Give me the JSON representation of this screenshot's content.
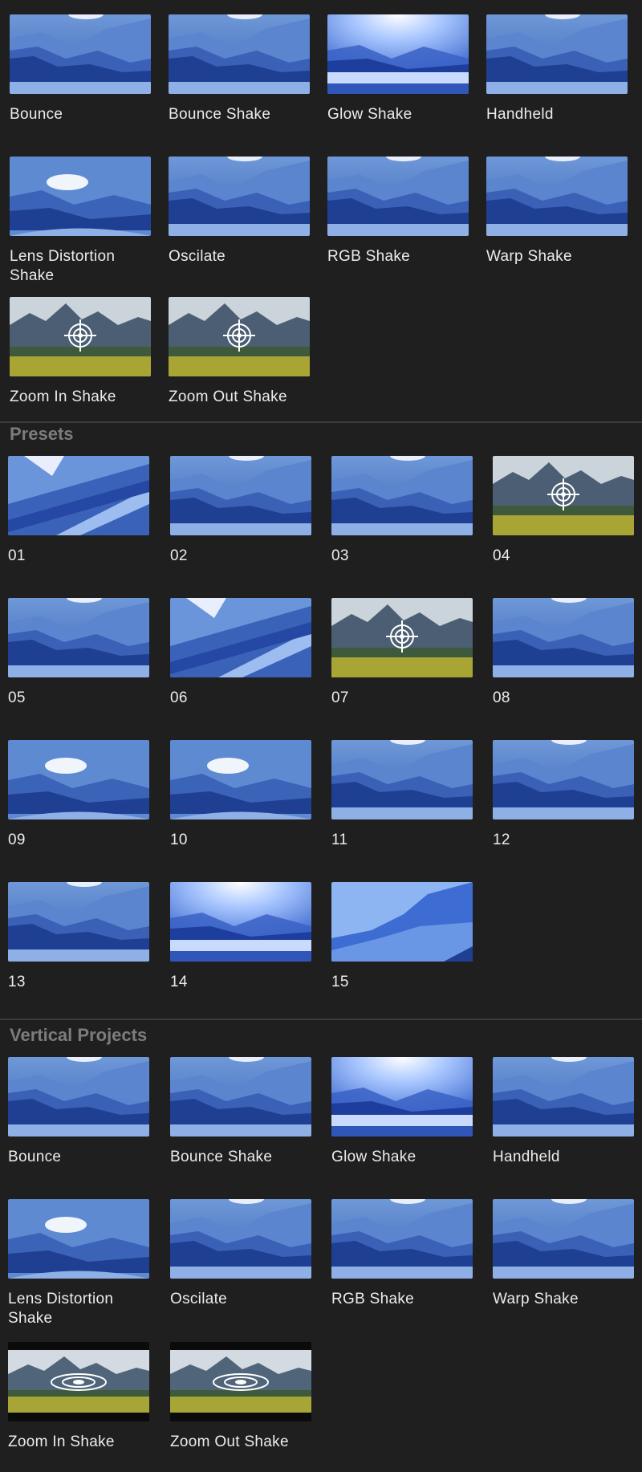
{
  "sections": [
    {
      "title": "",
      "items": [
        {
          "label": "Bounce",
          "thumb": "mountains-blue"
        },
        {
          "label": "Bounce Shake",
          "thumb": "mountains-blue"
        },
        {
          "label": "Glow Shake",
          "thumb": "mountains-glow"
        },
        {
          "label": "Handheld",
          "thumb": "mountains-blue"
        },
        {
          "label": "Lens Distortion Shake",
          "thumb": "mountains-lens"
        },
        {
          "label": "Oscilate",
          "thumb": "mountains-blue"
        },
        {
          "label": "RGB Shake",
          "thumb": "mountains-blue"
        },
        {
          "label": "Warp Shake",
          "thumb": "mountains-blue"
        },
        {
          "label": "Zoom In Shake",
          "thumb": "landscape-target"
        },
        {
          "label": "Zoom Out Shake",
          "thumb": "landscape-target"
        }
      ]
    },
    {
      "title": "Presets",
      "items": [
        {
          "label": "01",
          "thumb": "mountains-tilt"
        },
        {
          "label": "02",
          "thumb": "mountains-blue"
        },
        {
          "label": "03",
          "thumb": "mountains-blue"
        },
        {
          "label": "04",
          "thumb": "landscape-target"
        },
        {
          "label": "05",
          "thumb": "mountains-blue"
        },
        {
          "label": "06",
          "thumb": "mountains-tilt"
        },
        {
          "label": "07",
          "thumb": "landscape-target"
        },
        {
          "label": "08",
          "thumb": "mountains-blue"
        },
        {
          "label": "09",
          "thumb": "mountains-lens"
        },
        {
          "label": "10",
          "thumb": "mountains-lens"
        },
        {
          "label": "11",
          "thumb": "mountains-blue"
        },
        {
          "label": "12",
          "thumb": "mountains-blue"
        },
        {
          "label": "13",
          "thumb": "mountains-blue"
        },
        {
          "label": "14",
          "thumb": "mountains-glow"
        },
        {
          "label": "15",
          "thumb": "mountains-zoom"
        }
      ]
    },
    {
      "title": "Vertical Projects",
      "items": [
        {
          "label": "Bounce",
          "thumb": "mountains-blue"
        },
        {
          "label": "Bounce Shake",
          "thumb": "mountains-blue"
        },
        {
          "label": "Glow Shake",
          "thumb": "mountains-glow"
        },
        {
          "label": "Handheld",
          "thumb": "mountains-blue"
        },
        {
          "label": "Lens Distortion Shake",
          "thumb": "mountains-lens"
        },
        {
          "label": "Oscilate",
          "thumb": "mountains-blue"
        },
        {
          "label": "RGB Shake",
          "thumb": "mountains-blue"
        },
        {
          "label": "Warp Shake",
          "thumb": "mountains-blue"
        },
        {
          "label": "Zoom In Shake",
          "thumb": "landscape-target-wide"
        },
        {
          "label": "Zoom Out Shake",
          "thumb": "landscape-target-wide"
        }
      ]
    }
  ]
}
